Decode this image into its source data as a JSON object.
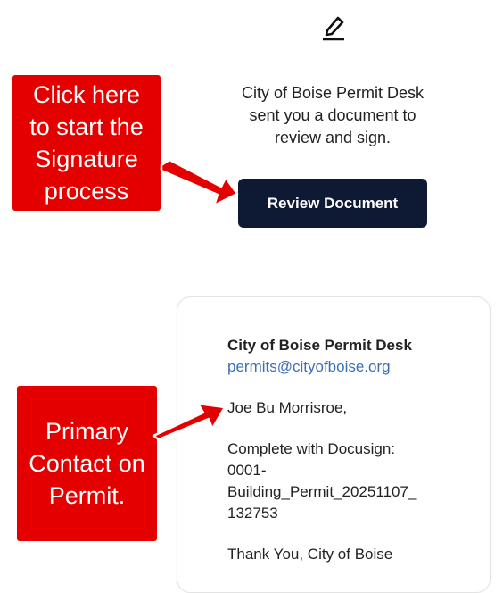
{
  "header": {
    "icon": "pen-icon"
  },
  "intro": {
    "line1": "City of Boise Permit Desk",
    "line2": "sent you a document to",
    "line3": "review and sign."
  },
  "review_button": "Review Document",
  "card": {
    "sender_name": "City of Boise Permit Desk",
    "sender_email": "permits@cityofboise.org",
    "greeting": "Joe Bu Morrisroe,",
    "line1": "Complete with Docusign:",
    "line2": "0001-",
    "line3": "Building_Permit_20251107_",
    "line4": "132753",
    "footer": "Thank You, City of Boise"
  },
  "callouts": {
    "signature": "Click here\nto start the\nSignature\nprocess",
    "contact": "Primary\nContact on\nPermit."
  },
  "colors": {
    "button_bg": "#0e1a33",
    "callout_bg": "#e50000",
    "link": "#3b6fb5"
  }
}
